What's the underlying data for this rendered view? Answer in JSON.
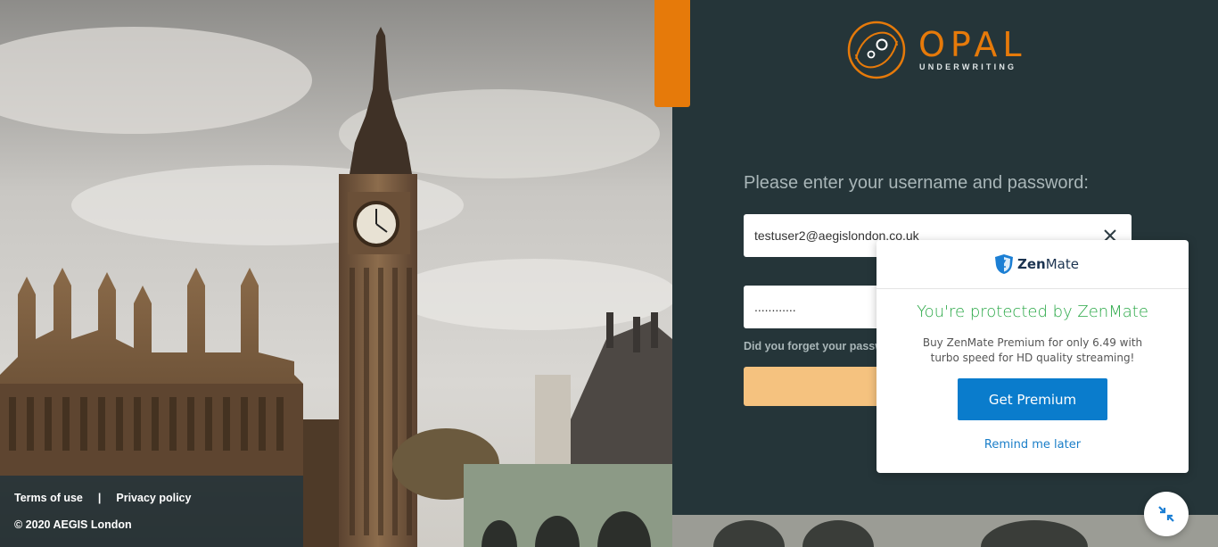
{
  "footer": {
    "terms_label": "Terms of use",
    "separator": "|",
    "privacy_label": "Privacy policy",
    "copyright": "© 2020 AEGIS London"
  },
  "brand": {
    "name": "OPAL",
    "tagline": "UNDERWRITING",
    "accent_color": "#e67a0a"
  },
  "login": {
    "prompt": "Please enter your username and password:",
    "username_value": "testuser2@aegislondon.co.uk",
    "password_value": "............",
    "forgot_label": "Did you forget your password?",
    "submit_label": ""
  },
  "zenmate": {
    "brand_zen": "Zen",
    "brand_mate": "Mate",
    "title": "You're protected by ZenMate",
    "description": "Buy ZenMate Premium for only 6.49 with turbo speed for HD quality streaming!",
    "premium_label": "Get Premium",
    "remind_label": "Remind me later",
    "title_color": "#28a745",
    "button_color": "#0a7ccc"
  },
  "icons": {
    "clear": "close-icon",
    "zen_shield": "shield-icon",
    "fab": "collapse-arrows-icon"
  }
}
